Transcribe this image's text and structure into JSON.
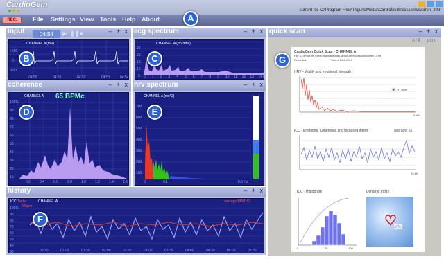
{
  "app": {
    "title": "CardioGem",
    "path": "current file C:\\Program Files\\TrigunaMedia\\CardioGem\\Sessions\\Martin_2.hrl"
  },
  "menu": {
    "rec_label": "REC.",
    "items": [
      "File",
      "Settings",
      "View",
      "Tools",
      "Help",
      "About"
    ]
  },
  "panel_controls": "– + x",
  "input": {
    "title": "input",
    "timer": "04:54",
    "channel_label": "CHANNEL A (mV)",
    "y_ticks": [
      "+500",
      "0",
      "-500"
    ],
    "x_ticks": [
      "04:50",
      "04:51",
      "04:52",
      "04:53",
      "04:54"
    ]
  },
  "ecg": {
    "title": "ecg spectrum",
    "channel_label": "CHANNEL A (mV/rms)",
    "y_ticks": [
      "25",
      "20",
      "15",
      "10",
      "5"
    ],
    "x_ticks": [
      "0",
      "1",
      "2",
      "3",
      "4",
      "5",
      "6",
      "7",
      "8",
      "9",
      "10",
      "11",
      "12",
      "13",
      "14 Hz"
    ]
  },
  "coherence": {
    "title": "coherence",
    "channel_label": "CHANNEL A",
    "bpm_value": "65 BPMc",
    "y_ticks": [
      "100%",
      "90",
      "80",
      "70",
      "60",
      "50",
      "40",
      "30",
      "20",
      "10"
    ],
    "x_ticks": [
      "0.2",
      "0.4",
      "0.6",
      "0.8",
      "1.0",
      "1.2",
      "1.4",
      "1.6Hz"
    ]
  },
  "hrv": {
    "title": "hrv spectrum",
    "channel_label": "CHANNEL A (ms^2)",
    "y_ticks": [
      "700",
      "600",
      "500",
      "400",
      "300",
      "200",
      "100"
    ],
    "x_ticks": [
      "0",
      "0.1",
      "0.5 Hz"
    ],
    "bar_colors": {
      "vlf": "#e53a2a",
      "lf": "#33c21a",
      "hf": "#2a3fd0"
    },
    "level_fill": 0.3
  },
  "history": {
    "title": "history",
    "legend_icc": "ICC",
    "legend_tacho": "Tacho",
    "legend_tacho_unit": "90bpm",
    "channel_label": "CHANNEL A",
    "average_bpm": "average BPM: 62",
    "y_ticks": [
      "100%",
      "90",
      "80",
      "70",
      "60",
      "50",
      "40",
      "30"
    ],
    "x_ticks": [
      "00:30",
      "01:00",
      "01:30",
      "02:00",
      "02:30",
      "03:00",
      "03:30",
      "04:00",
      "04:30",
      "05:00",
      "05:30"
    ]
  },
  "quick_scan": {
    "title": "quick scan",
    "ab_label": "A / B",
    "print_label": "print",
    "header_title": "CardioGem Quick Scan - CHANNEL A",
    "file_line": "File: C:\\Program Files\\TrigunaMedia\\CardioGem\\Sessions\\Martin_2.hrl",
    "recorded_label": "Recorded:",
    "printed_label": "Printed: 24-8-2010",
    "hrv_title": "HRV - Vitality and emotional strength",
    "hrv_bmp": "67 BMP",
    "hrv_y_ticks": [
      "125",
      "100",
      "75",
      "50",
      "25",
      "0"
    ],
    "hrv_x_tick": "0.5Hz",
    "icc_title": "ICC - Emotional Coherence and focussed intent",
    "icc_average": "average: 62",
    "icc_x_tick": "05:10",
    "hist_title": "ICC - Histogram",
    "hist_x_ticks": [
      "0",
      "50",
      "100"
    ],
    "dyn_title": "Dynamic Index",
    "dyn_value": "53"
  },
  "markers": [
    "A",
    "B",
    "C",
    "D",
    "E",
    "F",
    "G"
  ]
}
